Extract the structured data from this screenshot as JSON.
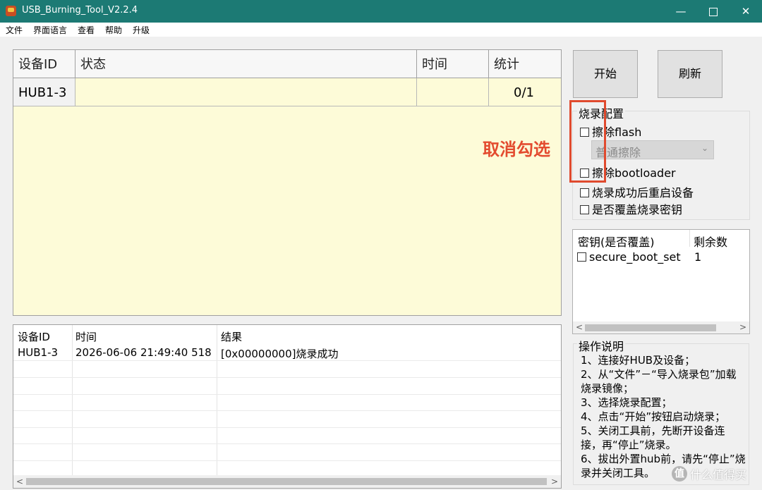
{
  "window": {
    "title": "USB_Burning_Tool_V2.2.4",
    "controls": {
      "minimize": "—",
      "close": "✕"
    }
  },
  "menu": [
    "文件",
    "界面语言",
    "查看",
    "帮助",
    "升级"
  ],
  "device_grid": {
    "columns": [
      "设备ID",
      "状态",
      "时间",
      "统计"
    ],
    "rows": [
      {
        "id": "HUB1-3",
        "status": "",
        "time": "",
        "count": "0/1"
      }
    ]
  },
  "log_table": {
    "columns": [
      "设备ID",
      "时间",
      "结果"
    ],
    "rows": [
      {
        "id": "HUB1-3",
        "time": "2026-06-06 21:49:40 518",
        "result": "[0x00000000]烧录成功"
      }
    ]
  },
  "buttons": {
    "start": "开始",
    "refresh": "刷新"
  },
  "burn_config": {
    "title": "烧录配置",
    "erase_flash": {
      "label": "擦除flash",
      "checked": false
    },
    "erase_mode": {
      "value": "普通擦除",
      "disabled": true
    },
    "erase_bootloader": {
      "label": "擦除bootloader",
      "checked": false
    },
    "reboot_after": {
      "label": "烧录成功后重启设备",
      "checked": false
    },
    "overwrite_key": {
      "label": "是否覆盖烧录密钥",
      "checked": false
    }
  },
  "annotation": {
    "text": "取消勾选",
    "color": "#e34b2f"
  },
  "key_list": {
    "columns": [
      "密钥(是否覆盖)",
      "剩余数"
    ],
    "rows": [
      {
        "name": "secure_boot_set",
        "remaining": "1",
        "checked": false
      }
    ]
  },
  "instructions": {
    "title": "操作说明",
    "lines": [
      "1、连接好HUB及设备；",
      "2、从“文件”－“导入烧录包”加载烧录镜像；",
      "3、选择烧录配置；",
      "4、点击“开始”按钮启动烧录；",
      "5、关闭工具前，先断开设备连接，再“停止”烧录。",
      "6、拔出外置hub前，请先“停止”烧录并关闭工具。"
    ]
  },
  "watermark": {
    "icon_text": "值",
    "text": "什么值得买"
  },
  "scroll_arrows": {
    "left": "<",
    "right": ">"
  }
}
